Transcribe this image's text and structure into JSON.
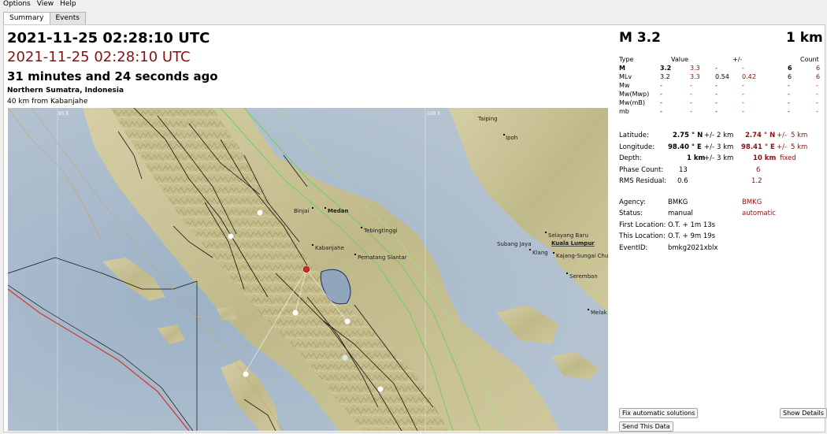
{
  "menu": [
    "Options",
    "View",
    "Help"
  ],
  "tabs": [
    "Summary",
    "Events"
  ],
  "header": {
    "time": "2021-11-25 02:28:10 UTC",
    "time_auto": "2021-11-25 02:28:10 UTC",
    "ago": "31 minutes and 24 seconds ago",
    "region": "Northern Sumatra, Indonesia",
    "nearest": "40 km from Kabanjahe"
  },
  "map": {
    "grid_labels": [
      "95 E",
      "100 E"
    ],
    "places": [
      "Taiping",
      "Ipoh",
      "Binjai",
      "Medan",
      "Tebingtinggi",
      "Kabanjahe",
      "Pematang Siantar",
      "Subang Jaya",
      "Selayang Baru",
      "Kuala Lumpur",
      "Klang",
      "Kajang-Sungai Chu",
      "Seremban",
      "Melak"
    ],
    "colors": {
      "sea": "#a6b7c9",
      "land": "#c9c296",
      "epicenter": "#e8202a",
      "station": "#ffffff",
      "plate": "#cf3c3c"
    }
  },
  "magnitude": {
    "title": "M 3.2",
    "depth_title": "1 km"
  },
  "mag_table": {
    "headers": {
      "type": "Type",
      "value": "Value",
      "pm": "+/-",
      "count": "Count"
    },
    "rows": [
      {
        "type": "M",
        "v1": "3.2",
        "v2": "3.3",
        "e1": "-",
        "e2": "-",
        "c1": "6",
        "c2": "6",
        "bold": true
      },
      {
        "type": "MLv",
        "v1": "3.2",
        "v2": "3.3",
        "e1": "0.54",
        "e2": "0.42",
        "c1": "6",
        "c2": "6",
        "bold": false
      },
      {
        "type": "Mw",
        "v1": "-",
        "v2": "-",
        "e1": "-",
        "e2": "-",
        "c1": "-",
        "c2": "-",
        "bold": false
      },
      {
        "type": "Mw(Mwp)",
        "v1": "-",
        "v2": "-",
        "e1": "-",
        "e2": "-",
        "c1": "-",
        "c2": "-",
        "bold": false
      },
      {
        "type": "Mw(mB)",
        "v1": "-",
        "v2": "-",
        "e1": "-",
        "e2": "-",
        "c1": "-",
        "c2": "-",
        "bold": false
      },
      {
        "type": "mb",
        "v1": "-",
        "v2": "-",
        "e1": "-",
        "e2": "-",
        "c1": "-",
        "c2": "-",
        "bold": false
      }
    ]
  },
  "location": {
    "latitude": {
      "label": "Latitude:",
      "v1": "2.75 ° N",
      "pm": "+/-",
      "e1": "2 km",
      "v2": "2.74 ° N",
      "e2": "5 km"
    },
    "longitude": {
      "label": "Longitude:",
      "v1": "98.40 ° E",
      "pm": "+/-",
      "e1": "3 km",
      "v2": "98.41 ° E",
      "e2": "5 km"
    },
    "depth": {
      "label": "Depth:",
      "v1": "1 km",
      "pm": "+/-",
      "e1": "3 km",
      "v2": "10 km",
      "e2": "fixed"
    },
    "phase_count": {
      "label": "Phase Count:",
      "v1": "13",
      "v2": "6"
    },
    "rms": {
      "label": "RMS Residual:",
      "v1": "0.6",
      "v2": "1.2"
    }
  },
  "info": {
    "agency": {
      "label": "Agency:",
      "v1": "BMKG",
      "v2": "BMKG"
    },
    "status": {
      "label": "Status:",
      "v1": "manual",
      "v2": "automatic"
    },
    "first_location": {
      "label": "First Location:",
      "v1": "O.T. + 1m 13s"
    },
    "this_location": {
      "label": "This Location:",
      "v1": "O.T. + 9m 19s"
    },
    "event_id": {
      "label": "EventID:",
      "v1": "bmkg2021xblx"
    }
  },
  "buttons": {
    "fix": "Fix automatic solutions",
    "show_details": "Show Details",
    "send": "Send This Data"
  }
}
